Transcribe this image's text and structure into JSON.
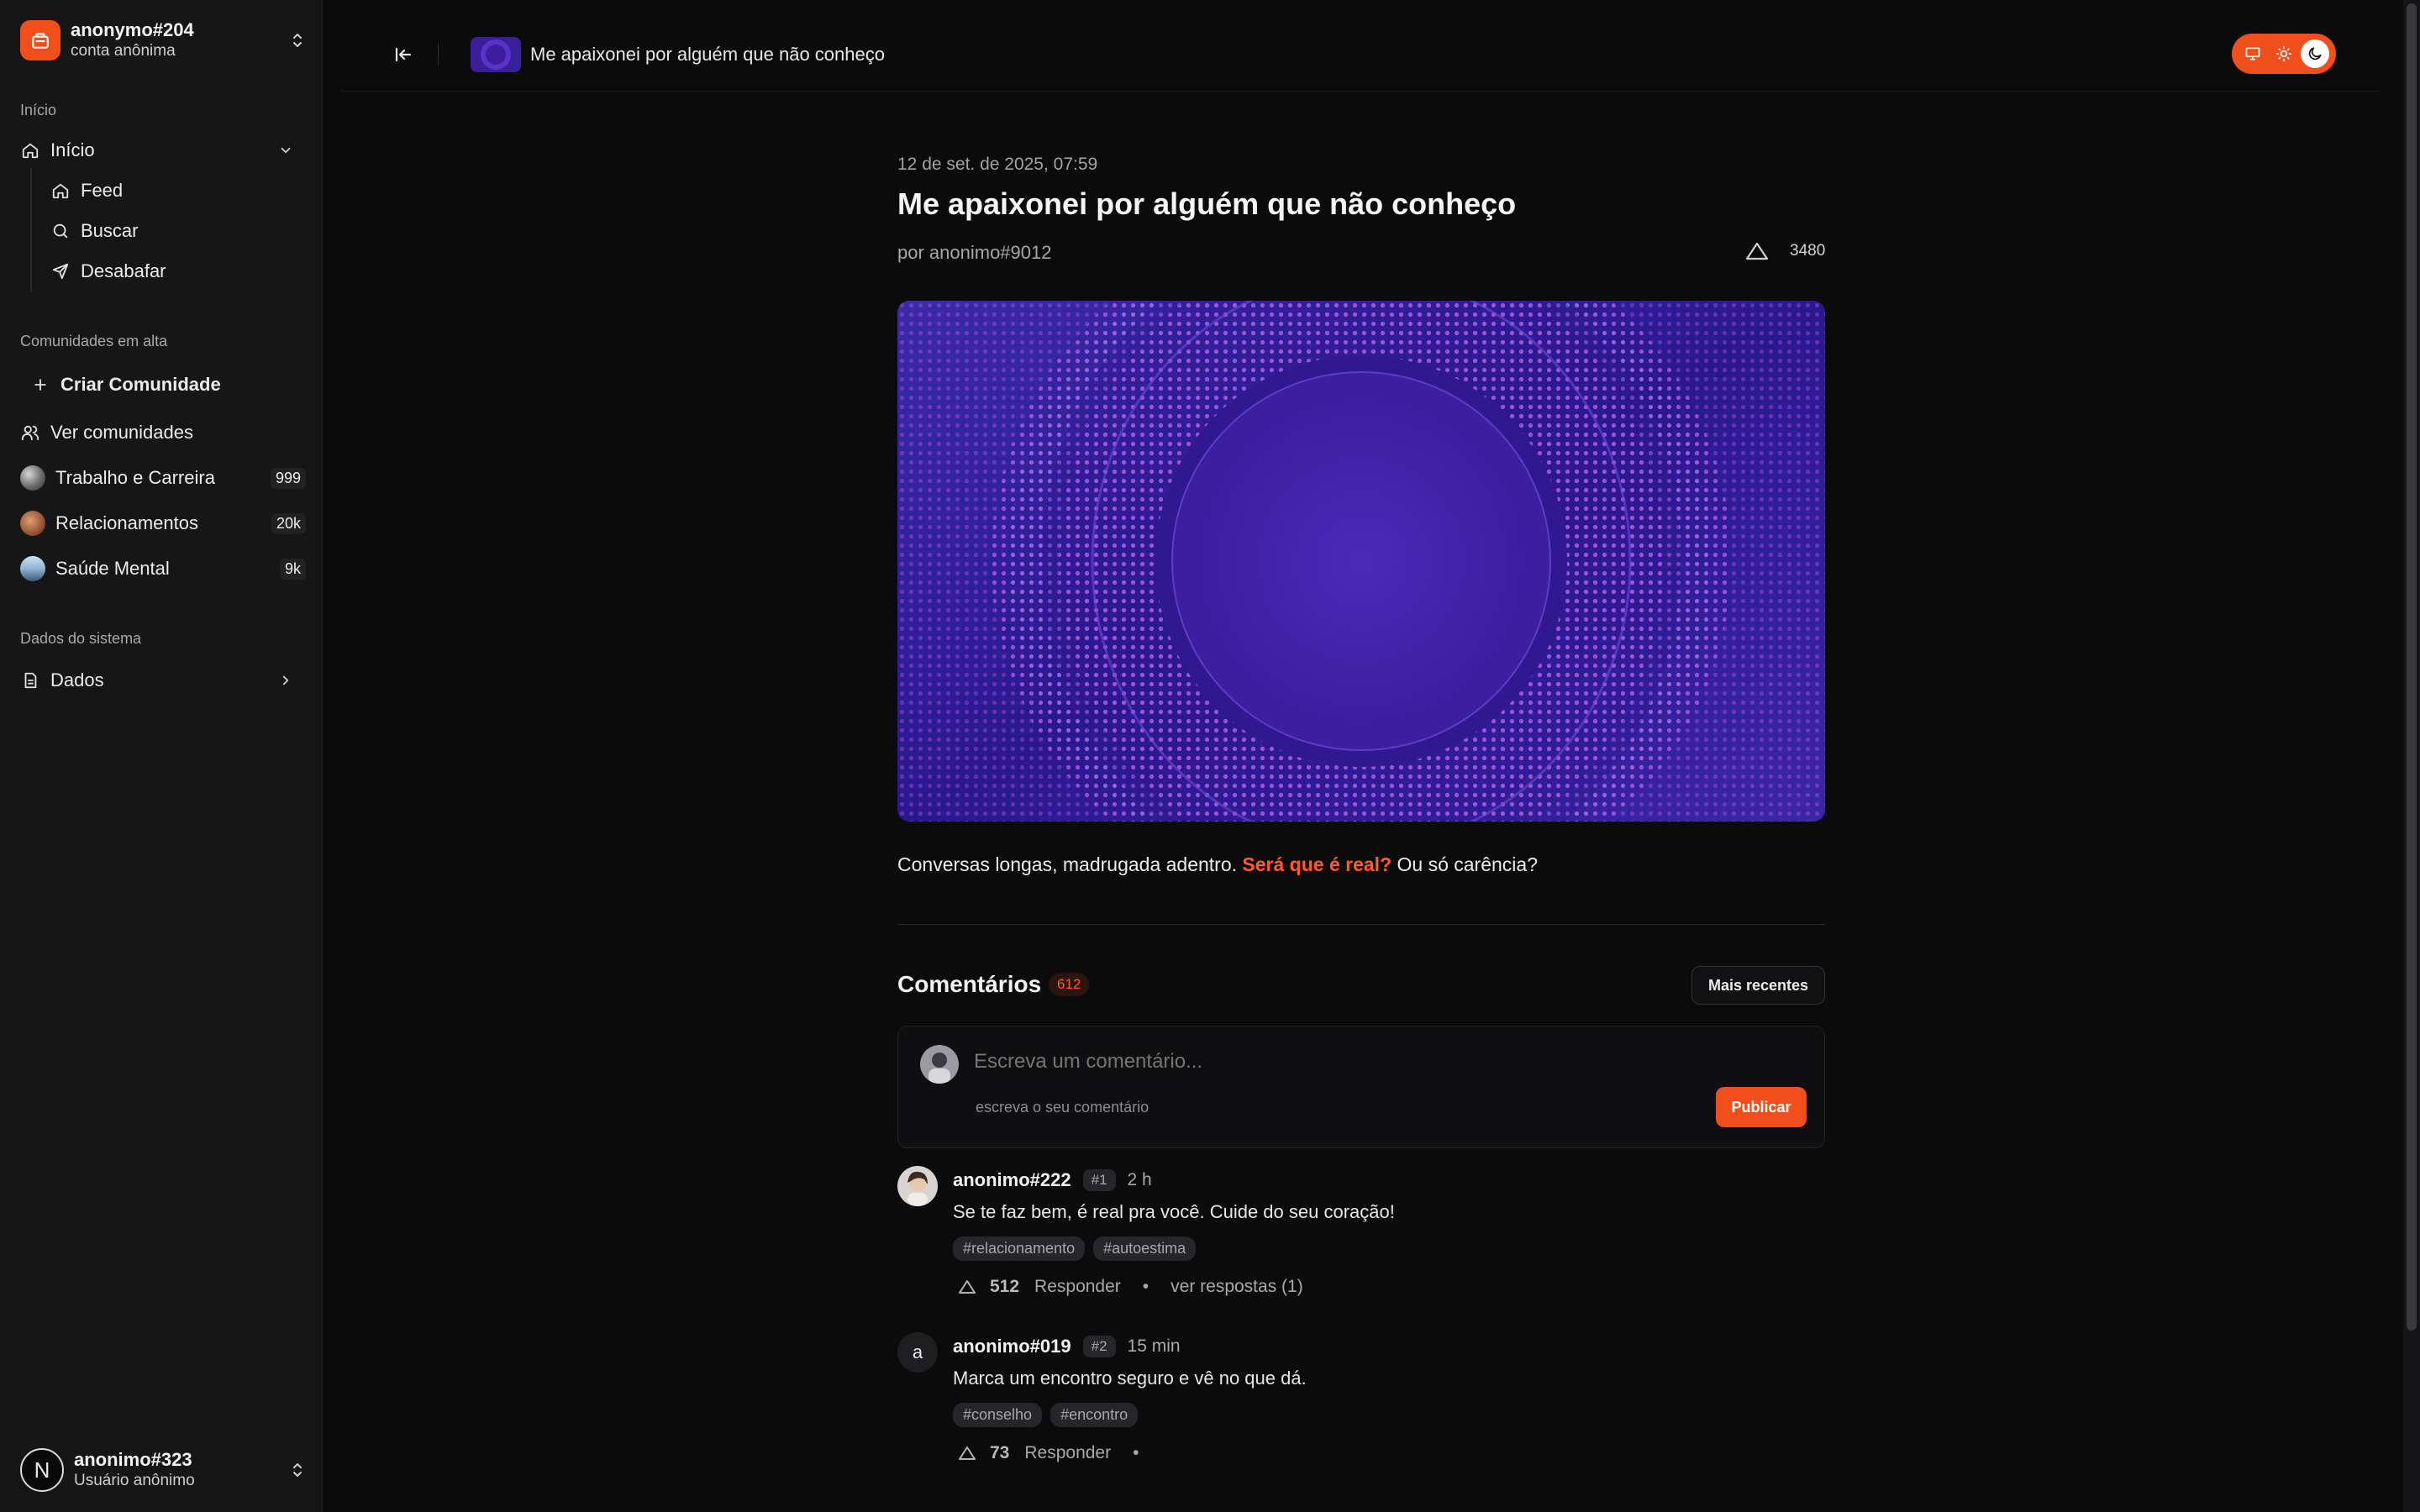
{
  "sidebar": {
    "account": {
      "name": "anonymo#204",
      "sub": "conta anônima"
    },
    "section_home": "Início",
    "home": {
      "label": "Início",
      "children": [
        "Feed",
        "Buscar",
        "Desabafar"
      ]
    },
    "section_communities": "Comunidades em alta",
    "create_community": "Criar Comunidade",
    "view_communities": "Ver comunidades",
    "communities": [
      {
        "name": "Trabalho e Carreira",
        "count": "999"
      },
      {
        "name": "Relacionamentos",
        "count": "20k"
      },
      {
        "name": "Saúde Mental",
        "count": "9k"
      }
    ],
    "section_system": "Dados do sistema",
    "data_item": "Dados",
    "user": {
      "initial": "N",
      "name": "anonimo#323",
      "sub": "Usuário anônimo"
    }
  },
  "topbar": {
    "title": "Me apaixonei por alguém que não conheço"
  },
  "post": {
    "date": "12 de set. de 2025, 07:59",
    "title": "Me apaixonei por alguém que não conheço",
    "author": "por anonimo#9012",
    "votes": "3480",
    "body_before": "Conversas longas, madrugada adentro.",
    "body_highlight": "Será que é real?",
    "body_after": "Ou só carência?"
  },
  "comments_section": {
    "title": "Comentários",
    "count": "612",
    "sort_label": "Mais recentes",
    "compose_placeholder": "Escreva um comentário...",
    "compose_hint": "escreva o seu comentário",
    "publish_label": "Publicar"
  },
  "comments": [
    {
      "author": "anonimo#222",
      "number": "#1",
      "time": "2 h",
      "text": "Se te faz bem, é real pra você. Cuide do seu coração!",
      "tags": [
        "#relacionamento",
        "#autoestima"
      ],
      "votes": "512",
      "reply_label": "Responder",
      "replies_label": "ver respostas (1)"
    },
    {
      "author": "anonimo#019",
      "initial": "a",
      "number": "#2",
      "time": "15 min",
      "text": "Marca um encontro seguro e vê no que dá.",
      "tags": [
        "#conselho",
        "#encontro"
      ],
      "votes": "73",
      "reply_label": "Responder"
    }
  ],
  "colors": {
    "accent": "#f04e1a",
    "highlight": "#ff5a2a",
    "background": "#0b0b0c",
    "sidebar": "#161617"
  }
}
